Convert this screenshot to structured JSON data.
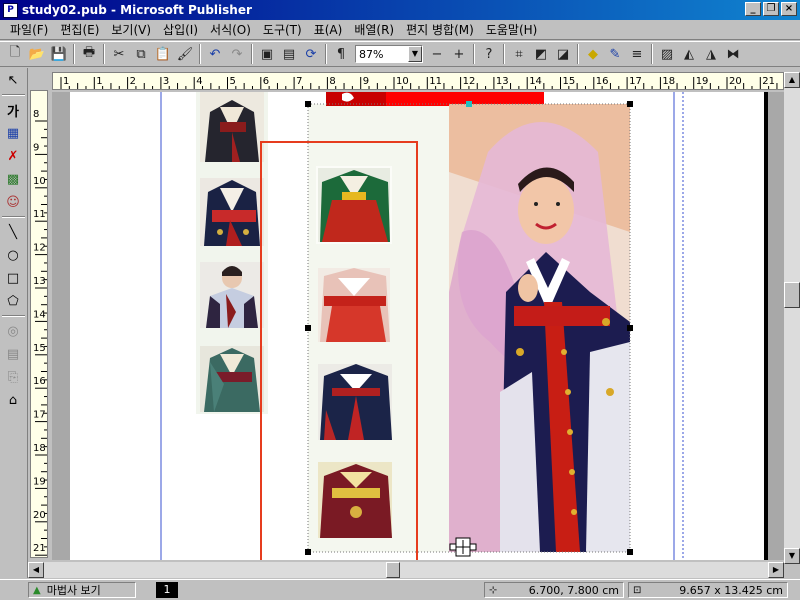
{
  "window": {
    "title": "study02.pub - Microsoft Publisher",
    "min": "_",
    "max": "❐",
    "close": "×"
  },
  "menu": [
    "파일(F)",
    "편집(E)",
    "보기(V)",
    "삽입(I)",
    "서식(O)",
    "도구(T)",
    "표(A)",
    "배열(R)",
    "편지 병합(M)",
    "도움말(H)"
  ],
  "toolbar": {
    "zoom": "87%"
  },
  "ruler": {
    "h_labels": [
      "1",
      "1",
      "2",
      "3",
      "4",
      "5",
      "6",
      "7",
      "8",
      "9",
      "10",
      "11",
      "12",
      "13",
      "14",
      "15",
      "16",
      "17",
      "18",
      "19",
      "20",
      "21"
    ],
    "v_labels": [
      "8",
      "9",
      "10",
      "11",
      "12",
      "13",
      "14",
      "15",
      "16",
      "17",
      "18",
      "19",
      "20",
      "21"
    ]
  },
  "status": {
    "wizard": "마법사 보기",
    "page": "1",
    "position": "6.700, 7.800 cm",
    "size": "9.657 x 13.425 cm"
  },
  "icons": [
    "new-icon",
    "open-icon",
    "save-icon",
    "print-icon",
    "cut-icon",
    "copy-icon",
    "paste-icon",
    "format-painter-icon",
    "undo-icon",
    "redo-icon",
    "bring-front-icon",
    "send-back-icon",
    "rotate-icon",
    "pilcrow-icon",
    "help-icon"
  ],
  "colors": {
    "accent": "#e63c1e",
    "title_start": "#00008a",
    "title_end": "#1084d0"
  }
}
